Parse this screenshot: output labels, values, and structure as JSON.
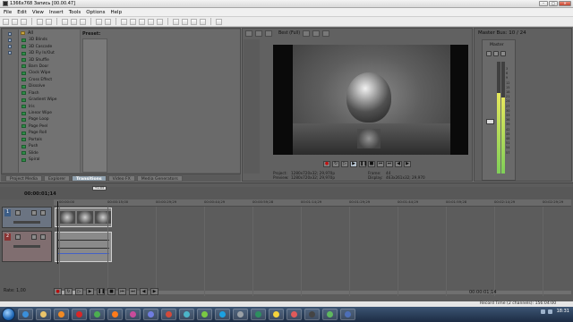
{
  "window": {
    "title": "1366x768  Запись [00.00.47]"
  },
  "menu": [
    "File",
    "Edit",
    "View",
    "Insert",
    "Tools",
    "Options",
    "Help"
  ],
  "explorer": {
    "preset_label": "Preset:",
    "root_item": "All",
    "transitions": [
      "3D Blinds",
      "3D Cascade",
      "3D Fly In/Out",
      "3D Shuffle",
      "Barn Door",
      "Clock Wipe",
      "Cross Effect",
      "Dissolve",
      "Flash",
      "Gradient Wipe",
      "Iris",
      "Linear Wipe",
      "Page Loop",
      "Page Peel",
      "Page Roll",
      "Portals",
      "Push",
      "Slide",
      "Spiral"
    ],
    "tabs": [
      "Project Media",
      "Explorer",
      "Transitions",
      "Video FX",
      "Media Generators"
    ],
    "active_tab": "Transitions"
  },
  "preview": {
    "quality": "Best (Full)",
    "project_label": "Project:",
    "project_value": "1280x720x32; 29,970p",
    "preview_label": "Preview:",
    "preview_value": "1280x720x32; 29,970p",
    "frame_label": "Frame:",
    "frame_value": "44",
    "display_label": "Display:",
    "display_value": "463x261x32; 29,970"
  },
  "master_bus": {
    "title": "Master Bus: 10 / 24",
    "name": "Master",
    "scale": [
      "3",
      "6",
      "9",
      "12",
      "15",
      "18",
      "21",
      "24",
      "27",
      "30",
      "33",
      "36",
      "39",
      "42",
      "45",
      "48",
      "51",
      "54",
      "57"
    ],
    "left_value": "0.0",
    "right_value": "0.0",
    "left_level": 0.72,
    "right_level": 0.68
  },
  "timeline": {
    "current_time": "00:00:01;14",
    "marker_label": "+1:05",
    "ruler_ticks": [
      "00:00:00",
      "00:00:15;00",
      "00:00:29;29",
      "00:00:44;29",
      "00:00:59;28",
      "00:01:14;29",
      "00:01:29;29",
      "00:01:44;29",
      "00:01:59;28",
      "00:02:14;29",
      "00:02:29;29"
    ],
    "video_track_number": "1",
    "audio_track_number": "2",
    "rate": "Rate: 1,00",
    "clock": "00:00:01;14",
    "record_time": "Record Time (2 channels): 156:04:00"
  },
  "taskbar": {
    "clock": "18:31",
    "icons": [
      {
        "name": "ie-icon",
        "color": "#3a8fdb"
      },
      {
        "name": "folder-icon",
        "color": "#e9c46a"
      },
      {
        "name": "media-player-icon",
        "color": "#f08a24"
      },
      {
        "name": "opera-icon",
        "color": "#d92626"
      },
      {
        "name": "chrome-icon",
        "color": "#4caf50"
      },
      {
        "name": "firefox-icon",
        "color": "#ff7b1a"
      },
      {
        "name": "app-icon-7",
        "color": "#c94b9b"
      },
      {
        "name": "app-icon-8",
        "color": "#6f7de0"
      },
      {
        "name": "app-icon-9",
        "color": "#d34a3a"
      },
      {
        "name": "app-icon-10",
        "color": "#4cb5c9"
      },
      {
        "name": "app-icon-11",
        "color": "#7ac943"
      },
      {
        "name": "skype-icon",
        "color": "#1ba1e2"
      },
      {
        "name": "app-icon-13",
        "color": "#9aa0a6"
      },
      {
        "name": "app-icon-14",
        "color": "#2d8f5f"
      },
      {
        "name": "app-icon-15",
        "color": "#f5d33b"
      },
      {
        "name": "app-icon-16",
        "color": "#e05a5a"
      },
      {
        "name": "app-icon-17",
        "color": "#444444"
      },
      {
        "name": "app-icon-18",
        "color": "#5fb85f"
      },
      {
        "name": "app-icon-19",
        "color": "#4d6fb8"
      }
    ]
  }
}
